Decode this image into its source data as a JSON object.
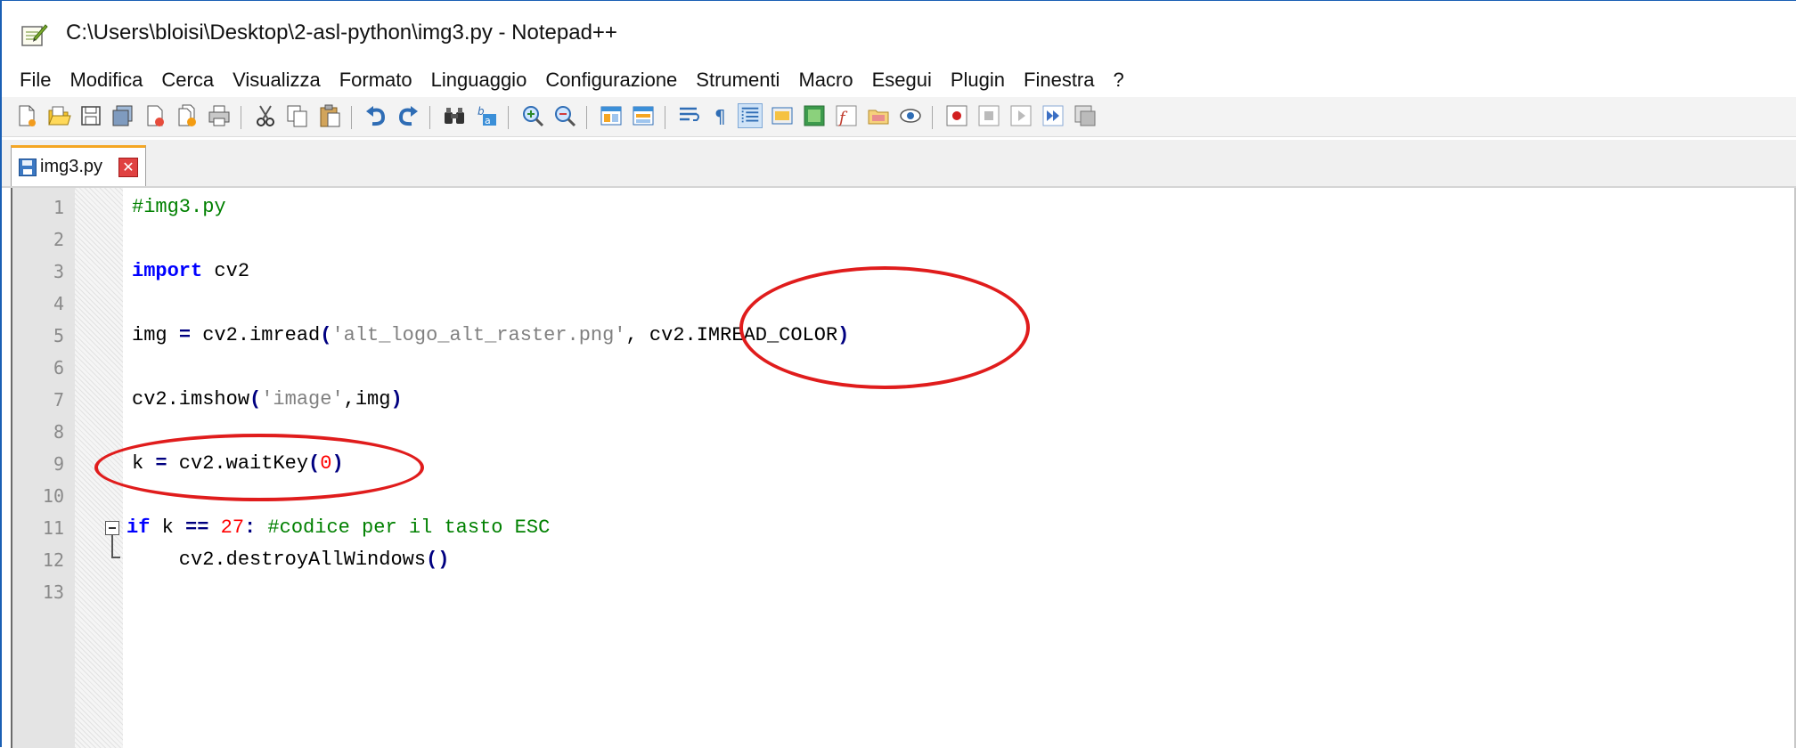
{
  "window": {
    "title": "C:\\Users\\bloisi\\Desktop\\2-asl-python\\img3.py - Notepad++"
  },
  "menu": [
    "File",
    "Modifica",
    "Cerca",
    "Visualizza",
    "Formato",
    "Linguaggio",
    "Configurazione",
    "Strumenti",
    "Macro",
    "Esegui",
    "Plugin",
    "Finestra",
    "?"
  ],
  "toolbar": {
    "buttons": [
      "new-file-icon",
      "open-file-icon",
      "save-icon",
      "save-all-icon",
      "close-icon",
      "close-all-icon",
      "print-icon",
      "cut-icon",
      "copy-icon",
      "paste-icon",
      "undo-icon",
      "redo-icon",
      "find-icon",
      "replace-icon",
      "zoom-in-icon",
      "zoom-out-icon",
      "sync-vertical-icon",
      "sync-horizontal-icon",
      "word-wrap-icon",
      "show-all-chars-icon",
      "indent-guide-icon",
      "udl-icon",
      "doc-map-icon",
      "function-list-icon",
      "folder-workspace-icon",
      "monitoring-icon",
      "record-macro-icon",
      "stop-macro-icon",
      "play-macro-icon",
      "run-macro-multiple-icon",
      "save-macro-icon"
    ]
  },
  "tab": {
    "label": "img3.py",
    "close": "✕"
  },
  "editor": {
    "lines": [
      {
        "n": "1",
        "text": "#img3.py"
      },
      {
        "n": "2",
        "text": ""
      },
      {
        "n": "3",
        "text": "import cv2"
      },
      {
        "n": "4",
        "text": ""
      },
      {
        "n": "5",
        "text": "img = cv2.imread('alt_logo_alt_raster.png', cv2.IMREAD_COLOR)"
      },
      {
        "n": "6",
        "text": ""
      },
      {
        "n": "7",
        "text": "cv2.imshow('image',img)"
      },
      {
        "n": "8",
        "text": ""
      },
      {
        "n": "9",
        "text": "k = cv2.waitKey(0)"
      },
      {
        "n": "10",
        "text": ""
      },
      {
        "n": "11",
        "text": "if k == 27: #codice per il tasto ESC"
      },
      {
        "n": "12",
        "text": "    cv2.destroyAllWindows()"
      },
      {
        "n": "13",
        "text": ""
      }
    ],
    "tokens": {
      "l1_comment": "#img3.py",
      "l3_kw": "import",
      "l3_rest": " cv2",
      "l5_a": "img ",
      "l5_eq": "=",
      "l5_b": " cv2.imread",
      "l5_p1": "(",
      "l5_str": "'alt_logo_alt_raster.png'",
      "l5_c": ", cv2.IMREAD_COLOR",
      "l5_p2": ")",
      "l7_a": "cv2.imshow",
      "l7_p1": "(",
      "l7_str": "'image'",
      "l7_b": ",img",
      "l7_p2": ")",
      "l9_a": "k ",
      "l9_eq": "=",
      "l9_b": " cv2.waitKey",
      "l9_p1": "(",
      "l9_num": "0",
      "l9_p2": ")",
      "l11_kw": "if",
      "l11_a": " k ",
      "l11_eq": "==",
      "l11_sp": " ",
      "l11_num": "27",
      "l11_colon": ":",
      "l11_cmt": " #codice per il tasto ESC",
      "l12_a": "    cv2.destroyAllWindows",
      "l12_p": "()"
    }
  },
  "annotation_color": "#e01c1c"
}
